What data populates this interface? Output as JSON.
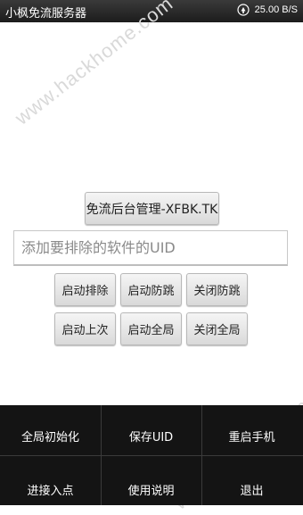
{
  "status_bar": {
    "app_title": "小枫免流服务器",
    "net_speed": "25.00 B/S"
  },
  "watermark": "www.hackhome.com",
  "main": {
    "admin_button": "免流后台管理-XFBK.TK",
    "uid_placeholder": "添加要排除的软件的UID",
    "row1": [
      "启动排除",
      "启动防跳",
      "关闭防跳"
    ],
    "row2": [
      "启动上次",
      "启动全局",
      "关闭全局"
    ]
  },
  "bottom_menu": {
    "row1": [
      "全局初始化",
      "保存UID",
      "重启手机"
    ],
    "row2": [
      "进接入点",
      "使用说明",
      "退出"
    ]
  }
}
